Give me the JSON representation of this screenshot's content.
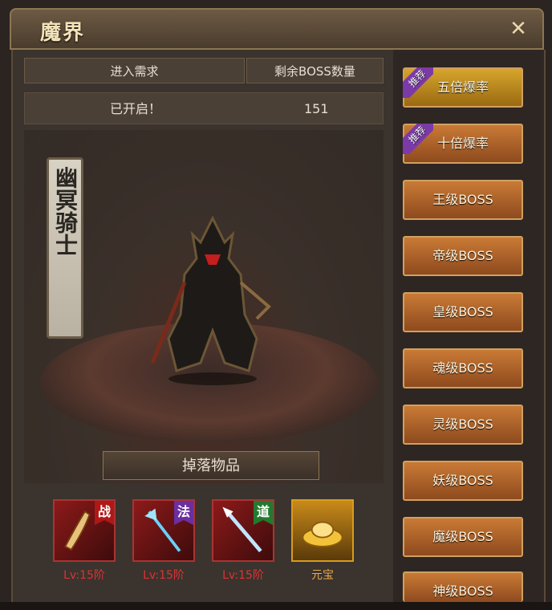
{
  "window": {
    "title": "魔界",
    "close_symbol": "✕"
  },
  "info": {
    "header_requirement": "进入需求",
    "header_remaining": "剩余BOSS数量",
    "requirement_value": "已开启！",
    "remaining_value": "151"
  },
  "boss": {
    "name": "幽冥骑士"
  },
  "drops": {
    "title": "掉落物品",
    "items": [
      {
        "tag": "战",
        "label": "Lv:15阶",
        "icon": "sword-icon"
      },
      {
        "tag": "法",
        "label": "Lv:15阶",
        "icon": "staff-icon"
      },
      {
        "tag": "道",
        "label": "Lv:15阶",
        "icon": "spear-icon"
      },
      {
        "tag": "",
        "label": "元宝",
        "icon": "gold-ingot-icon"
      }
    ]
  },
  "sidebar": {
    "buttons": [
      {
        "label": "五倍爆率",
        "badge": "推荐",
        "style": "gold"
      },
      {
        "label": "十倍爆率",
        "badge": "推荐",
        "style": "orange"
      },
      {
        "label": "王级BOSS",
        "badge": "",
        "style": "orange"
      },
      {
        "label": "帝级BOSS",
        "badge": "",
        "style": "orange"
      },
      {
        "label": "皇级BOSS",
        "badge": "",
        "style": "orange"
      },
      {
        "label": "魂级BOSS",
        "badge": "",
        "style": "orange"
      },
      {
        "label": "灵级BOSS",
        "badge": "",
        "style": "orange"
      },
      {
        "label": "妖级BOSS",
        "badge": "",
        "style": "orange"
      },
      {
        "label": "魔级BOSS",
        "badge": "",
        "style": "orange"
      },
      {
        "label": "神级BOSS",
        "badge": "",
        "style": "orange"
      }
    ]
  },
  "colors": {
    "accent": "#d6a52c",
    "badge_purple": "#7b3aa8",
    "drop_label_red": "#dd3333"
  }
}
